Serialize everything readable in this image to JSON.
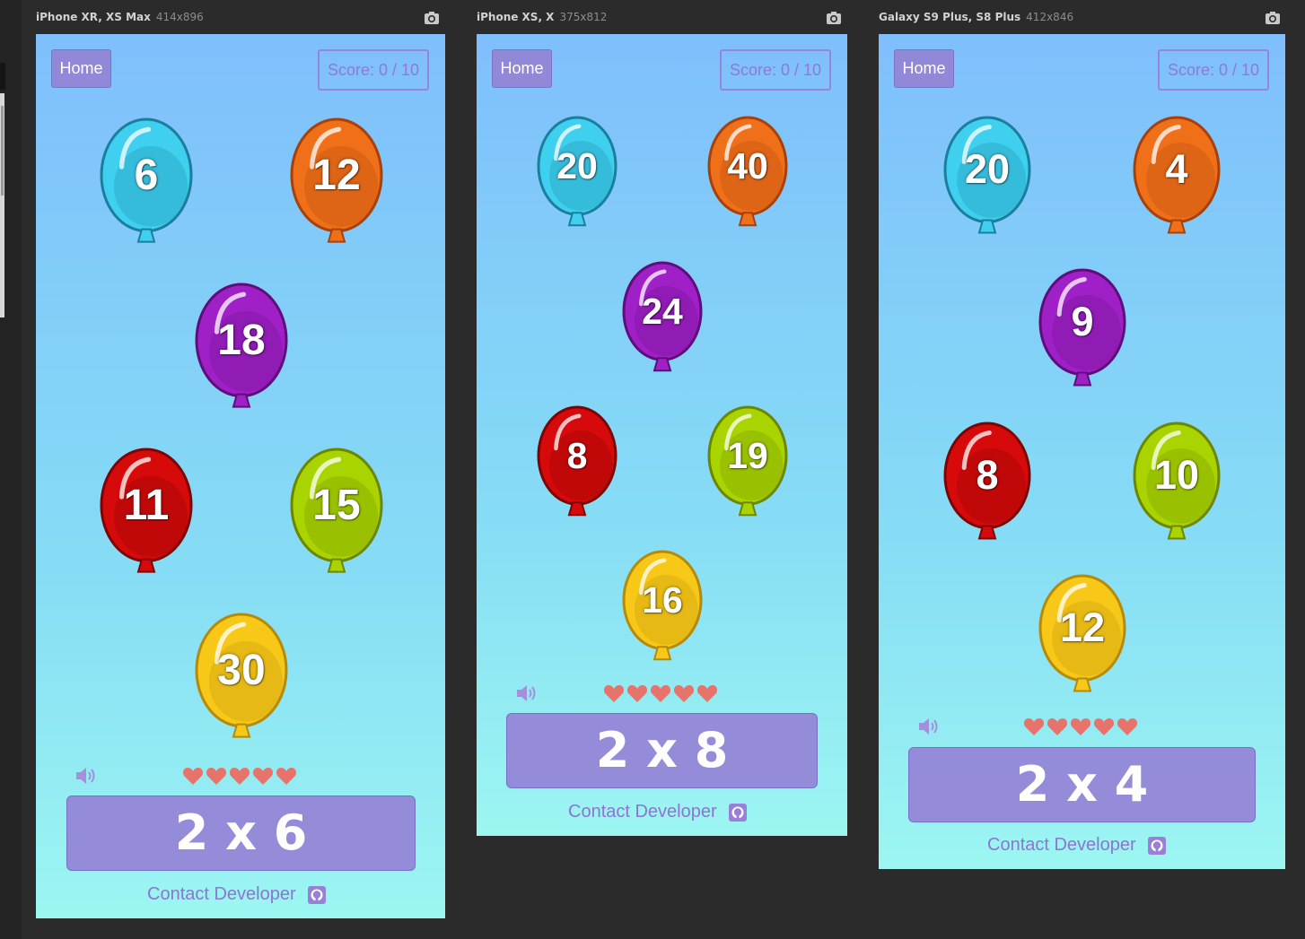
{
  "devices": [
    {
      "name": "iPhone XR, XS Max",
      "resolution": "414x896",
      "home_label": "Home",
      "score_text": "Score: 0 / 10",
      "balloons": [
        {
          "color": "blue",
          "value": "6"
        },
        {
          "color": "orange",
          "value": "12"
        },
        {
          "color": "purple",
          "value": "18"
        },
        {
          "color": "red",
          "value": "11"
        },
        {
          "color": "green",
          "value": "15"
        },
        {
          "color": "yellow",
          "value": "30"
        }
      ],
      "lives": 5,
      "question": "2 x 6",
      "contact_label": "Contact Developer"
    },
    {
      "name": "iPhone XS, X",
      "resolution": "375x812",
      "home_label": "Home",
      "score_text": "Score: 0 / 10",
      "balloons": [
        {
          "color": "blue",
          "value": "20"
        },
        {
          "color": "orange",
          "value": "40"
        },
        {
          "color": "purple",
          "value": "24"
        },
        {
          "color": "red",
          "value": "8"
        },
        {
          "color": "green",
          "value": "19"
        },
        {
          "color": "yellow",
          "value": "16"
        }
      ],
      "lives": 5,
      "question": "2 x 8",
      "contact_label": "Contact Developer"
    },
    {
      "name": "Galaxy S9 Plus, S8 Plus",
      "resolution": "412x846",
      "home_label": "Home",
      "score_text": "Score: 0 / 10",
      "balloons": [
        {
          "color": "blue",
          "value": "20"
        },
        {
          "color": "orange",
          "value": "4"
        },
        {
          "color": "purple",
          "value": "9"
        },
        {
          "color": "red",
          "value": "8"
        },
        {
          "color": "green",
          "value": "10"
        },
        {
          "color": "yellow",
          "value": "12"
        }
      ],
      "lives": 5,
      "question": "2 x 4",
      "contact_label": "Contact Developer"
    }
  ],
  "colors": {
    "workspace_bg": "#2b2b2b",
    "screen_top": "#7fbffc",
    "screen_bottom": "#9cf6f1",
    "button_bg": "#948cd8",
    "accent_text": "#8f74cf",
    "heart": "#e8736a",
    "balloon_blue": "#3fd0f0",
    "balloon_orange": "#f0701a",
    "balloon_purple": "#a020c8",
    "balloon_red": "#d60a0a",
    "balloon_green": "#aad400",
    "balloon_yellow": "#f7c818"
  },
  "icons": {
    "camera": "camera-icon",
    "speaker": "speaker-icon",
    "heart": "heart-icon",
    "github": "github-icon"
  }
}
